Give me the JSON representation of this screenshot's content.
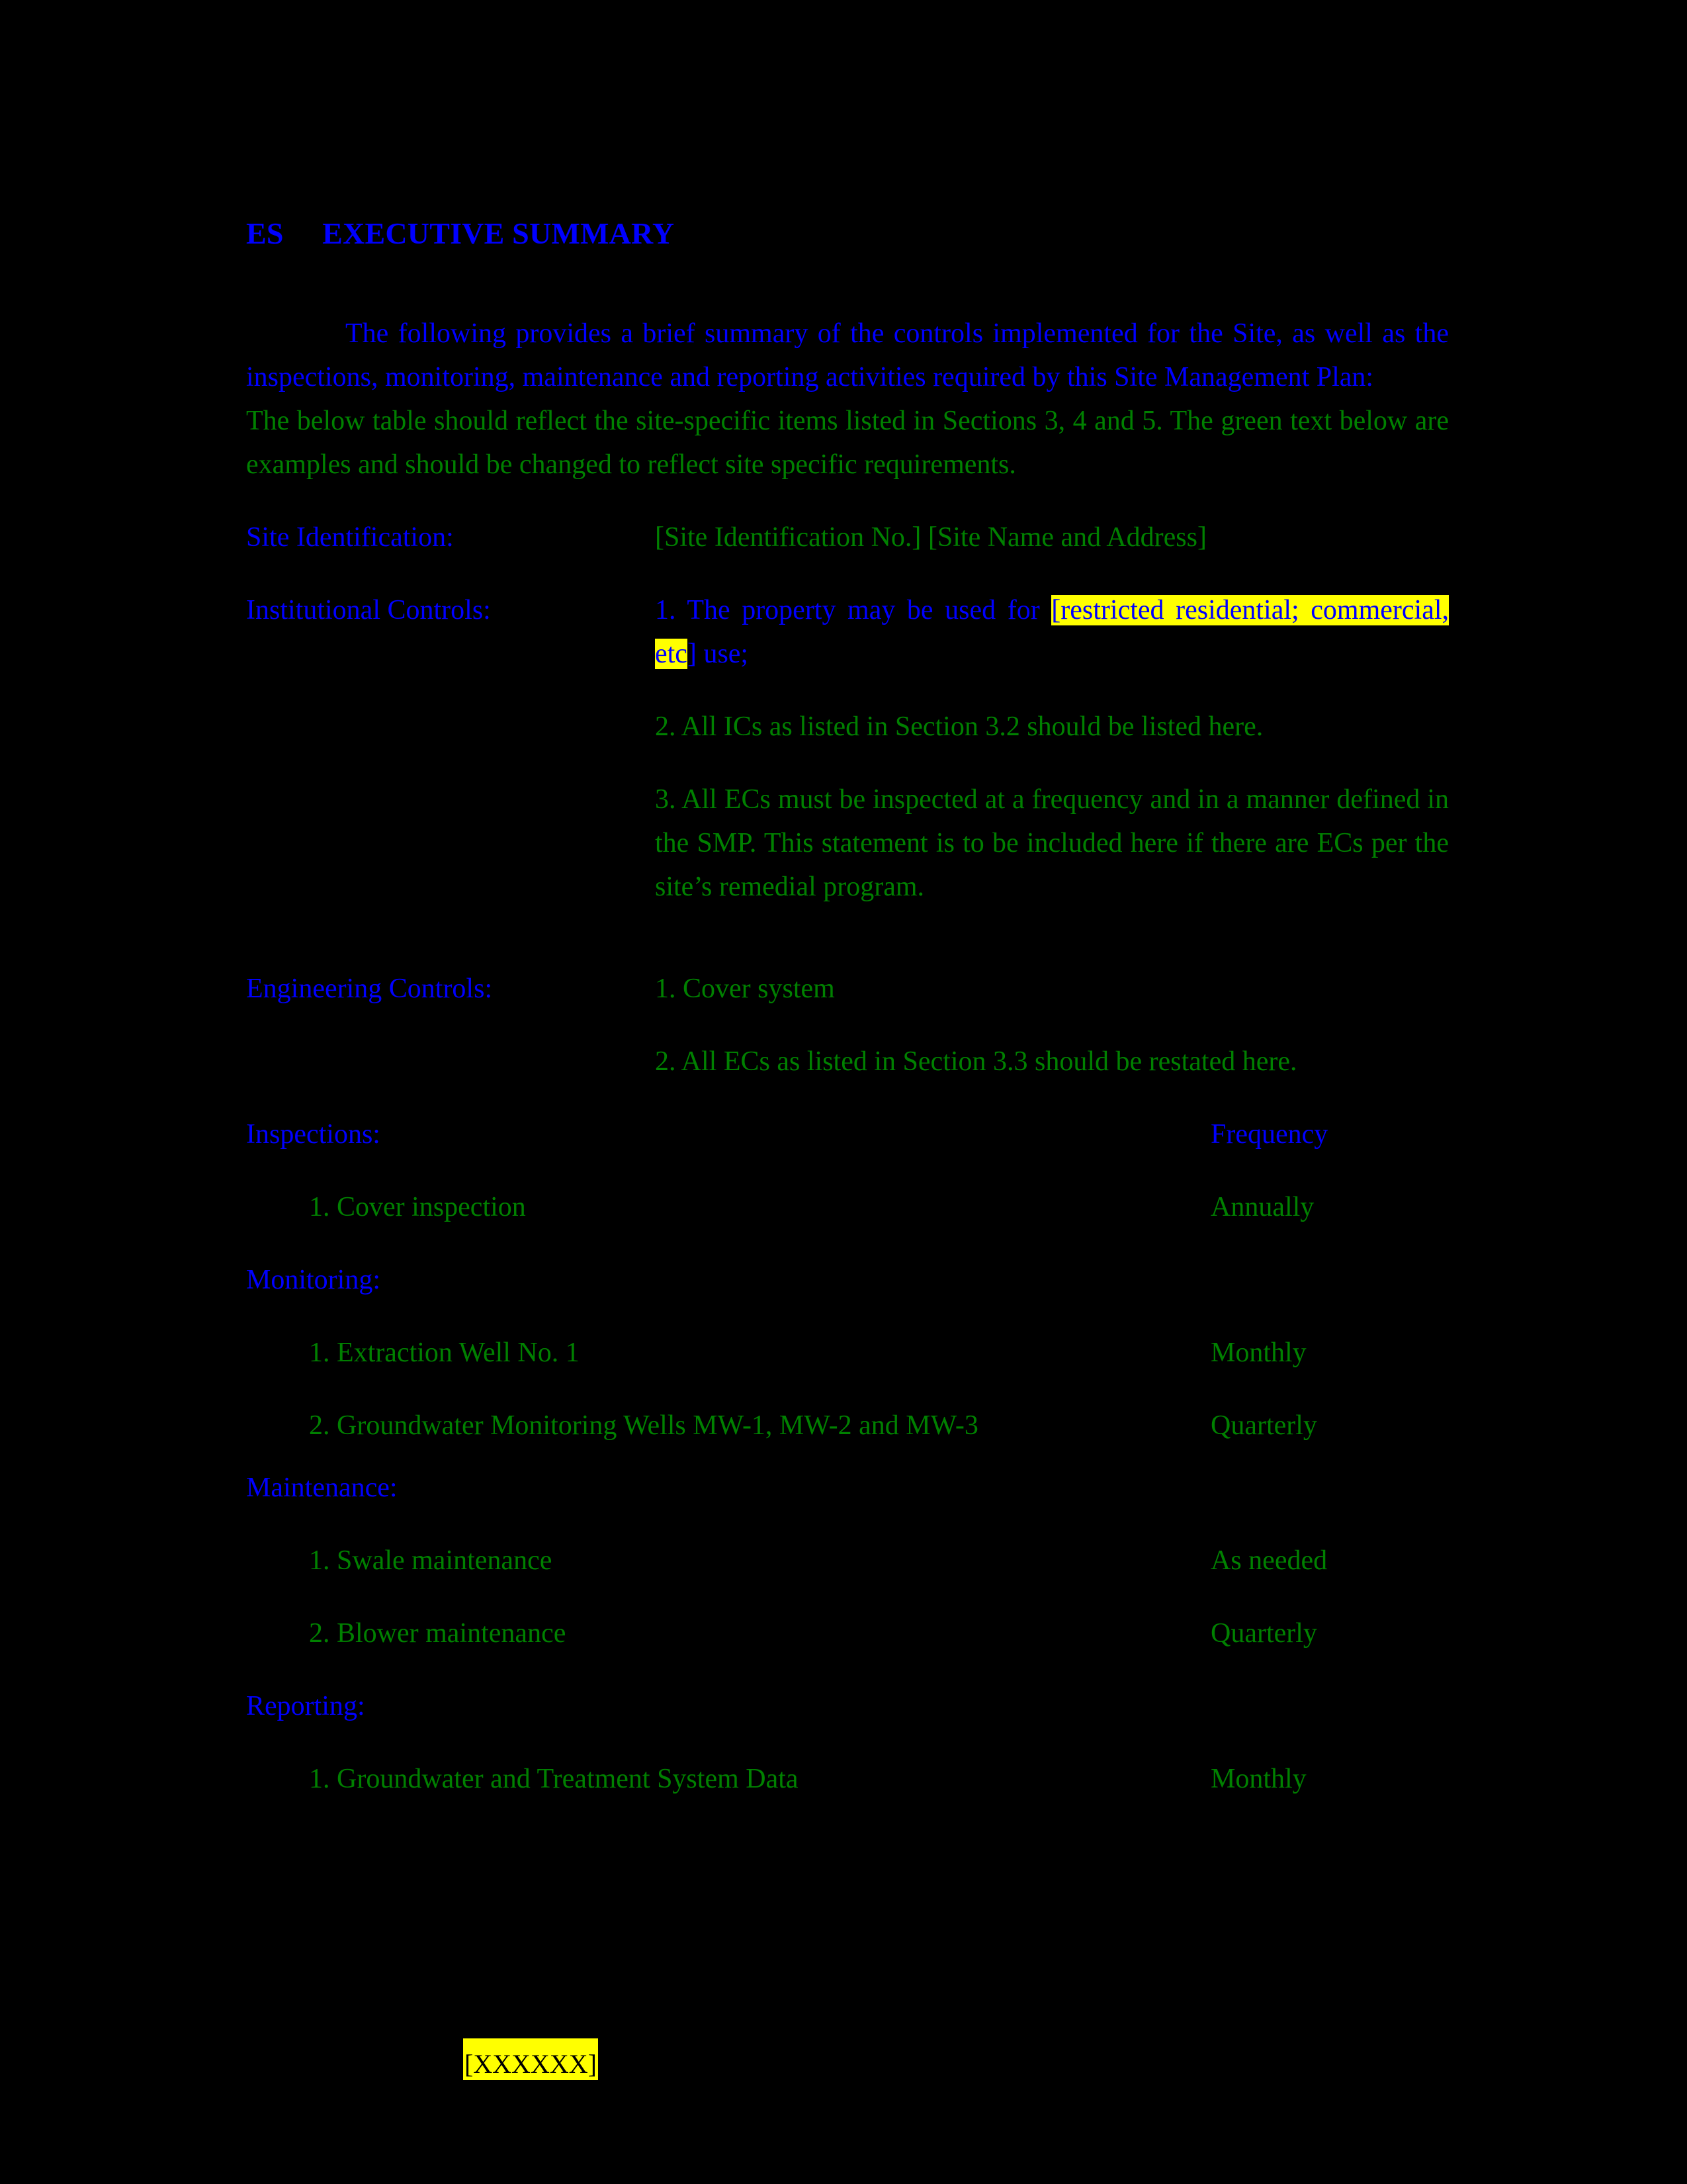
{
  "colors": {
    "background": "#000000",
    "blue_text": "#0000FF",
    "green_text": "#008000",
    "highlight": "#FFFF00",
    "highlight_text": "#000000"
  },
  "heading": {
    "number": "ES",
    "title": "EXECUTIVE SUMMARY"
  },
  "intro": {
    "blue_paragraph": "The following provides a brief summary of the controls implemented for the Site, as well as the inspections, monitoring, maintenance and reporting activities required by this Site Management Plan:",
    "green_paragraph": "The below table should reflect the site-specific items listed in Sections 3, 4 and 5.  The green text below are examples and should be changed to reflect site specific requirements."
  },
  "site_identification": {
    "label": "Site Identification:",
    "value": "[Site Identification No.]  [Site Name and Address]"
  },
  "institutional_controls": {
    "label": "Institutional Controls:",
    "items": [
      {
        "text_before": "1. The property may be used for ",
        "text_highlighted": "[restricted residential; commercial, etc",
        "text_after": "] use;"
      },
      {
        "text": "2. All ICs as listed in Section 3.2 should be listed here."
      },
      {
        "text": "3. All ECs must be inspected at a frequency and in a manner defined in the SMP. This statement is to be included here if there are ECs per the site’s remedial program."
      }
    ]
  },
  "engineering_controls": {
    "label": "Engineering Controls:",
    "items": [
      {
        "text": "1. Cover system"
      },
      {
        "text": "2. All ECs as listed in Section 3.3 should be restated here."
      }
    ]
  },
  "frequency_column_header": "Frequency",
  "inspections": {
    "label": "Inspections:",
    "items": [
      {
        "text": "1.   Cover inspection",
        "frequency": "Annually"
      }
    ]
  },
  "monitoring": {
    "label": "Monitoring:",
    "items": [
      {
        "text": "1.   Extraction Well No. 1",
        "frequency": "Monthly"
      },
      {
        "text": "2. Groundwater Monitoring Wells MW-1, MW-2 and MW-3",
        "frequency": "Quarterly"
      }
    ]
  },
  "maintenance": {
    "label": "Maintenance:",
    "items": [
      {
        "text": "1. Swale maintenance",
        "frequency": "As needed"
      },
      {
        "text": "2. Blower maintenance",
        "frequency": "Quarterly"
      }
    ]
  },
  "reporting": {
    "label": "Reporting:",
    "items": [
      {
        "text": "1. Groundwater and Treatment System Data",
        "frequency": "Monthly"
      }
    ]
  },
  "footer": {
    "tag": "[XXXXXX]"
  }
}
